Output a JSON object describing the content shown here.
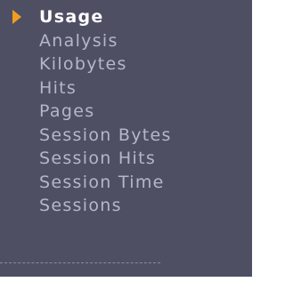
{
  "menu": {
    "items": [
      {
        "label": "Usage",
        "active": true
      },
      {
        "label": "Analysis"
      },
      {
        "label": "Kilobytes"
      },
      {
        "label": "Hits"
      },
      {
        "label": "Pages"
      },
      {
        "label": "Session Bytes"
      },
      {
        "label": "Session Hits"
      },
      {
        "label": "Session Time"
      },
      {
        "label": "Sessions"
      }
    ]
  },
  "colors": {
    "background": "#4f4f64",
    "text": "#b6b6c8",
    "active_text": "#ffffff",
    "arrow": "#f29d1c"
  },
  "icons": {
    "active_marker": "triangle-right-icon"
  }
}
